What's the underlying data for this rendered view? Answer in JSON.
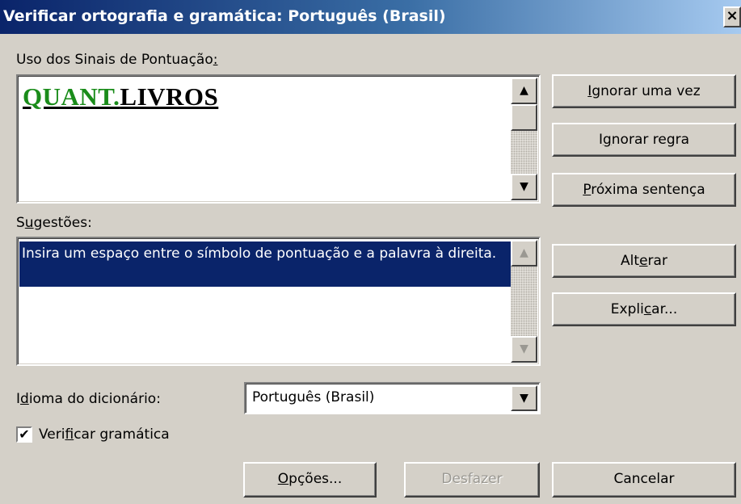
{
  "title": "Verificar ortografia e gramática: Português (Brasil)",
  "close_label": "×",
  "sentence_section": {
    "label_pre": "Uso dos Sinais de Pontuação",
    "label_acc": ":",
    "error_text": "QUANT.",
    "rest_text": "LIVROS"
  },
  "suggestions_section": {
    "label_pre": "S",
    "label_acc": "u",
    "label_post": "gestões:",
    "selected": "Insira um espaço entre o símbolo de pontuação e a palavra à direita."
  },
  "buttons": {
    "ignore_once": {
      "pre": "",
      "acc": "I",
      "post": "gnorar uma vez"
    },
    "ignore_rule": {
      "pre": "I",
      "acc": "g",
      "post": "norar regra"
    },
    "next_sentence": {
      "pre": "",
      "acc": "P",
      "post": "róxima sentença"
    },
    "change": {
      "pre": "Alt",
      "acc": "e",
      "post": "rar"
    },
    "explain": {
      "pre": "Expli",
      "acc": "c",
      "post": "ar..."
    },
    "options": {
      "pre": "",
      "acc": "O",
      "post": "pções..."
    },
    "undo": {
      "label": "Desfazer"
    },
    "cancel": {
      "label": "Cancelar"
    }
  },
  "dictionary": {
    "label_pre": "I",
    "label_acc": "d",
    "label_post": "ioma do dicionário:",
    "value": "Português (Brasil)"
  },
  "grammar_check": {
    "label_pre": "Veri",
    "label_acc": "f",
    "label_post": "icar gramática",
    "checked": true,
    "check_glyph": "✔"
  },
  "icons": {
    "up": "▲",
    "down": "▼"
  }
}
